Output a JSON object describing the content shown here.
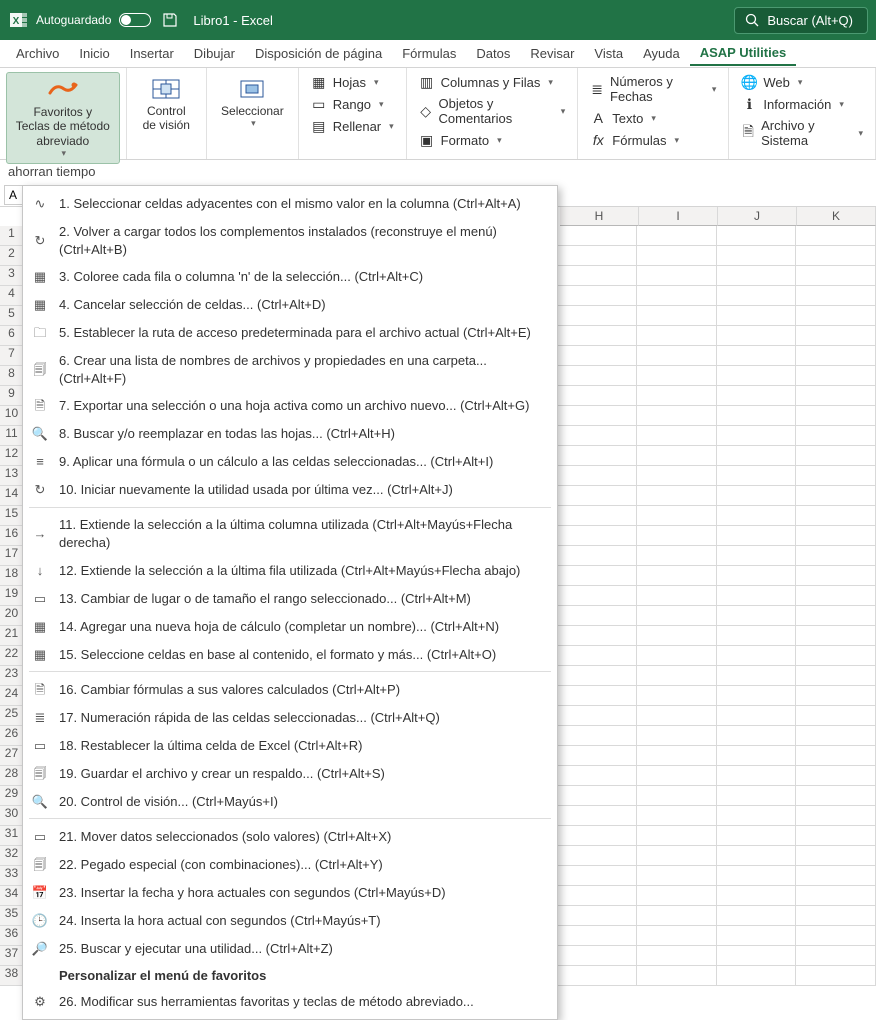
{
  "titlebar": {
    "autosave_label": "Autoguardado",
    "doc_title": "Libro1 - Excel",
    "search_label": "Buscar (Alt+Q)"
  },
  "tabs": [
    "Archivo",
    "Inicio",
    "Insertar",
    "Dibujar",
    "Disposición de página",
    "Fórmulas",
    "Datos",
    "Revisar",
    "Vista",
    "Ayuda",
    "ASAP Utilities"
  ],
  "active_tab": 10,
  "ribbon": {
    "favorites": "Favoritos y Teclas de método abreviado",
    "vision": "Control de visión",
    "select": "Seleccionar",
    "hojas": "Hojas",
    "rango": "Rango",
    "rellenar": "Rellenar",
    "columnas": "Columnas y Filas",
    "objetos": "Objetos y Comentarios",
    "formato": "Formato",
    "numeros": "Números y Fechas",
    "texto": "Texto",
    "formulas": "Fórmulas",
    "web": "Web",
    "informacion": "Información",
    "archivo": "Archivo y Sistema",
    "helptext": "ahorran tiempo"
  },
  "namebox": "A",
  "cols": [
    "H",
    "I",
    "J",
    "K"
  ],
  "rows": [
    1,
    2,
    3,
    4,
    5,
    6,
    7,
    8,
    9,
    10,
    11,
    12,
    13,
    14,
    15,
    16,
    17,
    18,
    19,
    20,
    21,
    22,
    23,
    24,
    25,
    26,
    27,
    28,
    29,
    30,
    31,
    32,
    33,
    34,
    35,
    36,
    37,
    38
  ],
  "menu": {
    "items": [
      {
        "n": "1.",
        "t": "Seleccionar celdas adyacentes con el mismo valor en la columna (Ctrl+Alt+A)",
        "u": "S"
      },
      {
        "n": "2.",
        "t": "Volver a cargar todos los complementos instalados (reconstruye el menú) (Ctrl+Alt+B)",
        "u": "V"
      },
      {
        "n": "3.",
        "t": "Coloree cada fila o columna 'n' de la selección... (Ctrl+Alt+C)",
        "u": "n"
      },
      {
        "n": "4.",
        "t": "Cancelar selección de celdas... (Ctrl+Alt+D)",
        "u": "C"
      },
      {
        "n": "5.",
        "t": "Establecer la ruta de acceso predeterminada para el archivo actual (Ctrl+Alt+E)",
        "u": "E"
      },
      {
        "n": "6.",
        "t": "Crear una lista de nombres de archivos y propiedades en una carpeta... (Ctrl+Alt+F)",
        "u": "C"
      },
      {
        "n": "7.",
        "t": "Exportar una selección o una hoja activa como un archivo nuevo... (Ctrl+Alt+G)",
        "u": "x"
      },
      {
        "n": "8.",
        "t": "Buscar y/o reemplazar en todas las hojas... (Ctrl+Alt+H)",
        "u": "B"
      },
      {
        "n": "9.",
        "t": "Aplicar una fórmula o un cálculo a las celdas seleccionadas... (Ctrl+Alt+I)",
        "u": "A"
      },
      {
        "n": "10.",
        "t": "Iniciar nuevamente la utilidad usada por última vez... (Ctrl+Alt+J)",
        "u": "I"
      }
    ],
    "items2": [
      {
        "n": "11.",
        "t": "Extiende la selección a la última columna utilizada (Ctrl+Alt+Mayús+Flecha derecha)",
        "u": "x"
      },
      {
        "n": "12.",
        "t": "Extiende la selección a la última fila utilizada (Ctrl+Alt+Mayús+Flecha abajo)",
        "u": "x"
      },
      {
        "n": "13.",
        "t": "Cambiar de lugar o de tamaño el rango seleccionado... (Ctrl+Alt+M)",
        "u": "m"
      },
      {
        "n": "14.",
        "t": "Agregar una nueva hoja de cálculo (completar un nombre)... (Ctrl+Alt+N)",
        "u": "n"
      },
      {
        "n": "15.",
        "t": "Seleccione celdas en base al contenido, el formato y más... (Ctrl+Alt+O)",
        "u": "e"
      }
    ],
    "items3": [
      {
        "n": "16.",
        "t": "Cambiar fórmulas a sus valores calculados (Ctrl+Alt+P)",
        "u": "f"
      },
      {
        "n": "17.",
        "t": "Numeración rápida de las celdas seleccionadas... (Ctrl+Alt+Q)",
        "u": "N"
      },
      {
        "n": "18.",
        "t": "Restablecer la última celda de Excel (Ctrl+Alt+R)",
        "u": "d"
      },
      {
        "n": "19.",
        "t": "Guardar el archivo y crear un respaldo... (Ctrl+Alt+S)",
        "u": "v"
      },
      {
        "n": "20.",
        "t": "Control de visión... (Ctrl+Mayús+I)",
        "u": "C"
      }
    ],
    "items4": [
      {
        "n": "21.",
        "t": "Mover datos seleccionados (solo valores) (Ctrl+Alt+X)",
        "u": "s"
      },
      {
        "n": "22.",
        "t": "Pegado especial (con combinaciones)... (Ctrl+Alt+Y)",
        "u": "P"
      },
      {
        "n": "23.",
        "t": "Insertar la fecha y hora actuales con segundos (Ctrl+Mayús+D)",
        "u": "h"
      },
      {
        "n": "24.",
        "t": "Inserta la hora actual con segundos (Ctrl+Mayús+T)",
        "u": "h"
      },
      {
        "n": "25.",
        "t": "Buscar y ejecutar una utilidad... (Ctrl+Alt+Z)",
        "u": "e"
      }
    ],
    "header": "Personalizar el menú de favoritos",
    "items5": [
      {
        "n": "26.",
        "t": "Modificar sus herramientas favoritas y teclas de método abreviado...",
        "u": "M"
      }
    ]
  }
}
